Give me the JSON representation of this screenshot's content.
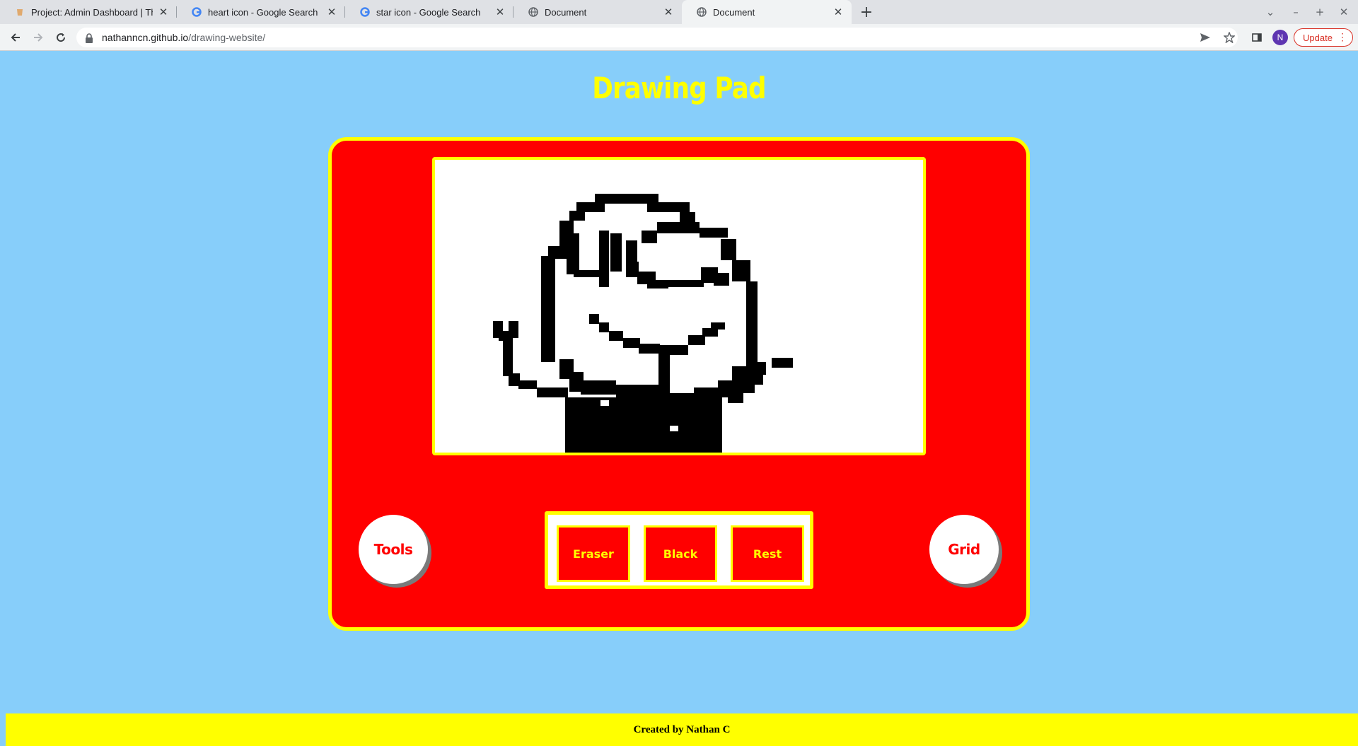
{
  "browser": {
    "tabs": [
      {
        "title": "Project: Admin Dashboard | Th",
        "icon": "odin-icon",
        "active": false
      },
      {
        "title": "heart icon - Google Search",
        "icon": "google-icon",
        "active": false
      },
      {
        "title": "star icon - Google Search",
        "icon": "google-icon",
        "active": false
      },
      {
        "title": "Document",
        "icon": "globe-icon",
        "active": false
      },
      {
        "title": "Document",
        "icon": "globe-icon",
        "active": true
      }
    ],
    "url_host": "nathanncn.github.io",
    "url_path": "/drawing-website/",
    "avatar_letter": "N",
    "update_label": "Update"
  },
  "page": {
    "title": "Drawing Pad",
    "tools_label": "Tools",
    "grid_label": "Grid",
    "buttons": {
      "eraser": "Eraser",
      "black": "Black",
      "reset": "Rest"
    },
    "footer": "Created by Nathan C"
  },
  "colors": {
    "background": "#87cefa",
    "frame": "#ff0000",
    "accent": "#ffff00",
    "ink": "#000000"
  }
}
